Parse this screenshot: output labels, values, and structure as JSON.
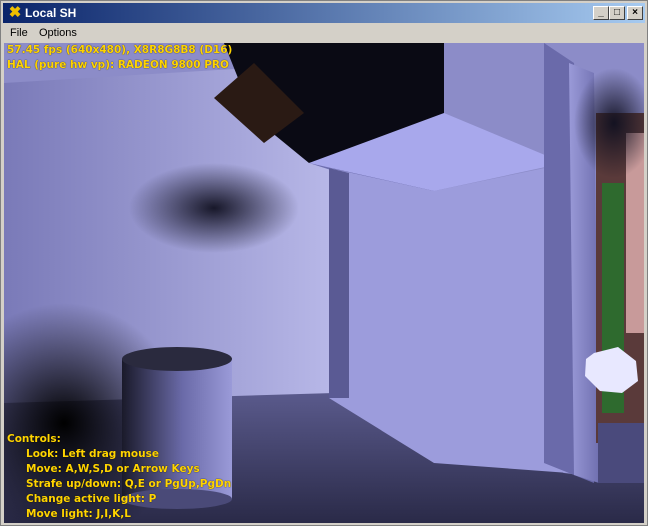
{
  "window": {
    "title": "Local SH",
    "app_icon": "dx-icon",
    "controls": {
      "minimize": "_",
      "maximize": "□",
      "close": "×"
    }
  },
  "menu": {
    "file": "File",
    "options": "Options"
  },
  "hud": {
    "stats_line1": "57.45 fps (640x480), X8R8G8B8 (D16)",
    "stats_line2": "HAL (pure hw vp): RADEON 9800 PRO"
  },
  "controls_help": {
    "title": "Controls:",
    "lines": [
      "Look: Left drag mouse",
      "Move: A,W,S,D or Arrow Keys",
      "Strafe up/down: Q,E or PgUp,PgDn",
      "Change active light: P",
      "Move light: J,I,K,L"
    ]
  },
  "colors": {
    "hud_text": "#ffd400",
    "title_bar": "#0a246a",
    "scene_wall": "#8a8ac8"
  }
}
